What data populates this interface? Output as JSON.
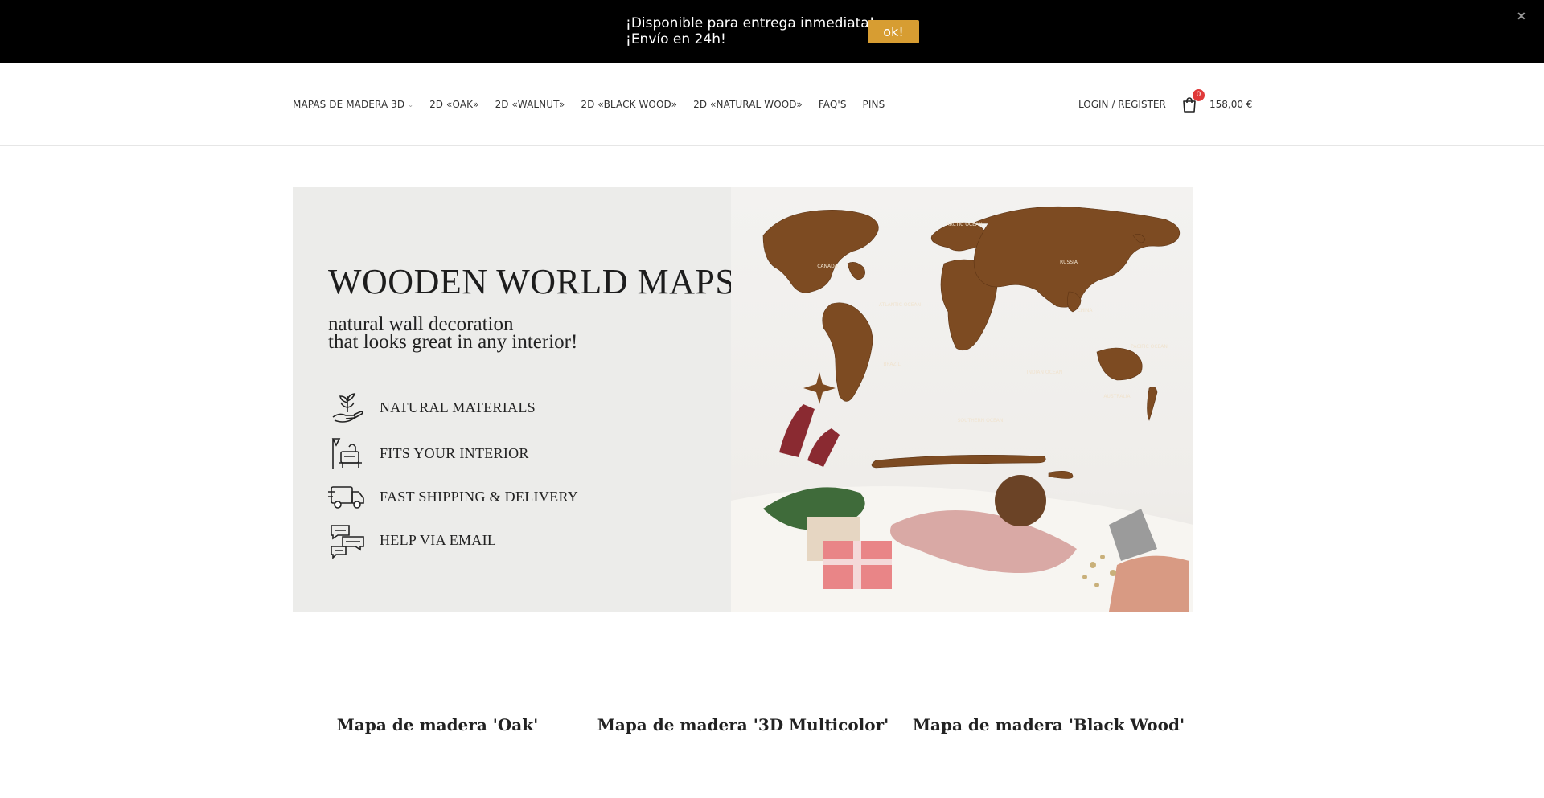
{
  "notice": {
    "line1": "¡Disponible para entrega inmediata!",
    "line2": "¡Envío en 24h!",
    "ok_label": "ok!",
    "close_label": "✕"
  },
  "nav": {
    "items": [
      {
        "label": "MAPAS DE MADERA 3D",
        "has_dropdown": true
      },
      {
        "label": "2D «OAK»"
      },
      {
        "label": "2D «WALNUT»"
      },
      {
        "label": "2D «BLACK WOOD»"
      },
      {
        "label": "2D «NATURAL WOOD»"
      },
      {
        "label": "FAQ'S"
      },
      {
        "label": "PINS"
      }
    ],
    "account_label": "LOGIN / REGISTER",
    "cart_count": "0",
    "cart_total": "158,00 €"
  },
  "hero": {
    "title": "WOODEN WORLD MAPS",
    "subtitle_line1": "natural wall decoration",
    "subtitle_line2": "that looks great in any interior!",
    "features": [
      {
        "label": "NATURAL MATERIALS",
        "icon": "plant-hand-icon"
      },
      {
        "label": "FITS YOUR INTERIOR",
        "icon": "interior-icon"
      },
      {
        "label": "FAST SHIPPING & DELIVERY",
        "icon": "truck-icon"
      },
      {
        "label": "HELP VIA EMAIL",
        "icon": "chat-icon"
      }
    ],
    "map_labels": [
      "CANADA",
      "ATLANTIC OCEAN",
      "BRAZIL",
      "RUSSIA",
      "CHINA",
      "INDIAN OCEAN",
      "PACIFIC OCEAN",
      "SOUTHERN OCEAN",
      "ARCTIC OCEAN",
      "AUSTRALIA"
    ]
  },
  "products": [
    {
      "title": "Mapa de madera 'Oak'"
    },
    {
      "title": "Mapa de madera '3D Multicolor'"
    },
    {
      "title": "Mapa de madera 'Black Wood'"
    }
  ],
  "colors": {
    "notice_bg": "#000000",
    "ok_button": "#d79d32",
    "cart_badge": "#e03a3a",
    "map_wood": "#7a4a22"
  }
}
